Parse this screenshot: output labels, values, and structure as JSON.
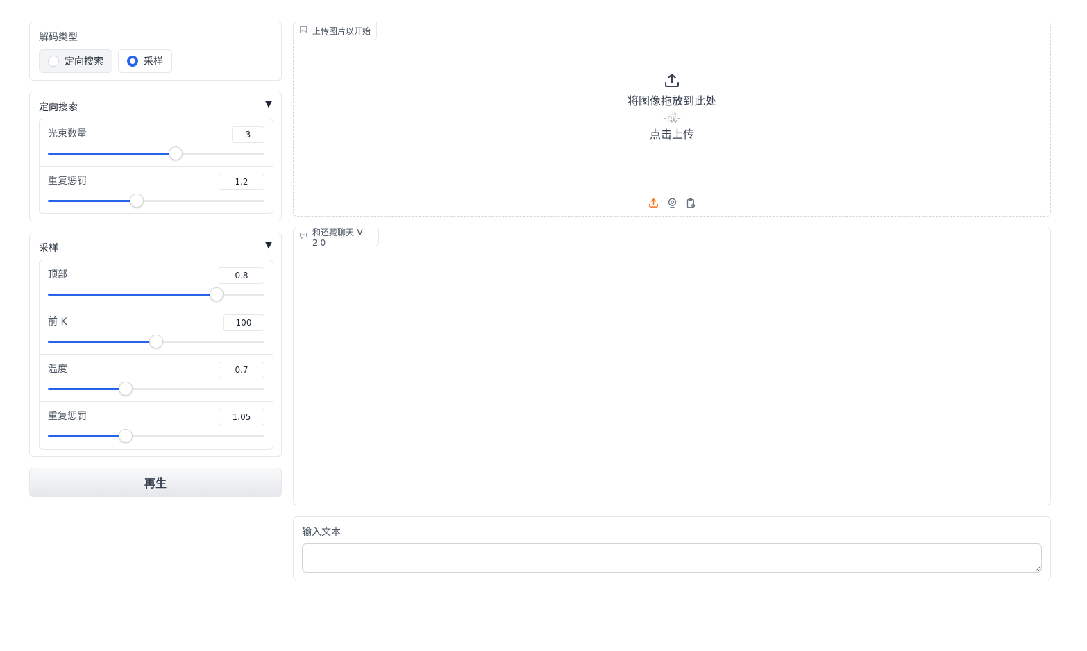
{
  "decoding": {
    "label": "解码类型",
    "options": [
      {
        "label": "定向搜索",
        "checked": false
      },
      {
        "label": "采样",
        "checked": true
      }
    ]
  },
  "beam_search": {
    "title": "定向搜索",
    "arrow": "▼",
    "sliders": [
      {
        "label": "光束数量",
        "value": "3",
        "fraction": 0.59
      },
      {
        "label": "重复惩罚",
        "value": "1.2",
        "fraction": 0.41
      }
    ]
  },
  "sampling": {
    "title": "采样",
    "arrow": "▼",
    "sliders": [
      {
        "label": "顶部",
        "value": "0.8",
        "fraction": 0.78
      },
      {
        "label": "前 K",
        "value": "100",
        "fraction": 0.5
      },
      {
        "label": "温度",
        "value": "0.7",
        "fraction": 0.36
      },
      {
        "label": "重复惩罚",
        "value": "1.05",
        "fraction": 0.36
      }
    ]
  },
  "regenerate_label": "再生",
  "upload": {
    "tag": "上传图片以开始",
    "drop_text": "将图像拖放到此处",
    "or_text": "-或-",
    "click_text": "点击上传"
  },
  "chat": {
    "tag": "和还藏聊天-V 2.0"
  },
  "text_input": {
    "label": "输入文本",
    "value": "",
    "placeholder": ""
  },
  "colors": {
    "accent": "#2563eb",
    "upload_source_active": "#f97316"
  }
}
